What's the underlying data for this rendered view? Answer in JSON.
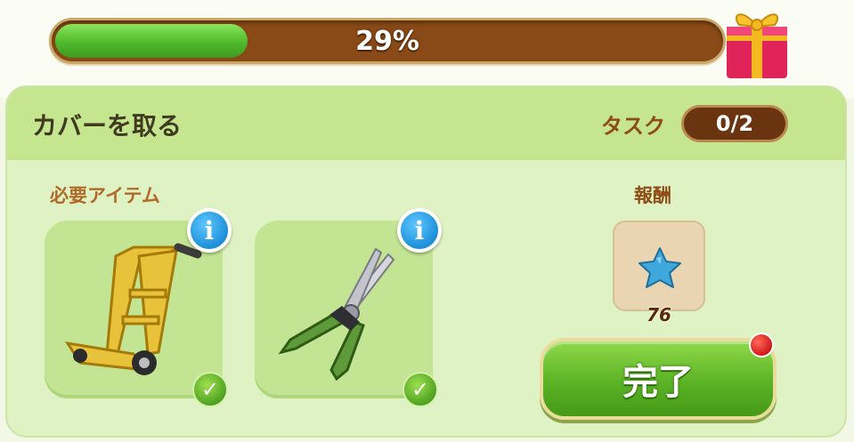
{
  "progress": {
    "value": 0.29,
    "label": "29%"
  },
  "gift_icon": "gift-box-icon",
  "panel": {
    "title": "カバーを取る",
    "task_label": "タスク",
    "task_count": "0/2",
    "required_items_label": "必要アイテム",
    "reward_label": "報酬"
  },
  "items": [
    {
      "name": "hand-truck",
      "info_glyph": "i",
      "check_glyph": "✓",
      "completed": true
    },
    {
      "name": "pruning-shears",
      "info_glyph": "i",
      "check_glyph": "✓",
      "completed": true
    }
  ],
  "reward": {
    "icon": "blue-star-gem-icon",
    "count": "76"
  },
  "complete_button": {
    "label": "完了",
    "has_notification": true
  },
  "colors": {
    "progress_fill": "#4fb92c",
    "progress_track": "#8a4a17",
    "panel_bg": "#dff2c3",
    "panel_header": "#c5e58f",
    "button_green": "#5bb325",
    "notification_red": "#d11818"
  }
}
